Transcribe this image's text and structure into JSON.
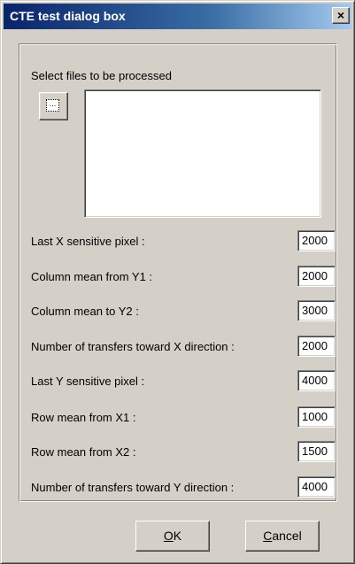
{
  "window": {
    "title": "CTE test dialog box",
    "close_glyph": "×"
  },
  "files": {
    "label": "Select files to be processed",
    "browse_glyph": "..."
  },
  "params": [
    {
      "label": "Last X sensitive pixel :",
      "value": "2000"
    },
    {
      "label": "Column mean from Y1 :",
      "value": "2000"
    },
    {
      "label": "Column mean to Y2 :",
      "value": "3000"
    },
    {
      "label": "Number of transfers toward X direction :",
      "value": "2000"
    },
    {
      "label": "Last Y sensitive pixel :",
      "value": "4000"
    },
    {
      "label": "Row mean from X1 :",
      "value": "1000"
    },
    {
      "label": "Row mean from X2 :",
      "value": "1500"
    },
    {
      "label": "Number of transfers toward Y direction :",
      "value": "4000"
    }
  ],
  "buttons": {
    "ok_first": "O",
    "ok_rest": "K",
    "cancel_first": "C",
    "cancel_rest": "ancel"
  },
  "colors": {
    "title_gradient_start": "#0a246a",
    "title_gradient_end": "#a6caf0",
    "face": "#d4d0c8"
  }
}
